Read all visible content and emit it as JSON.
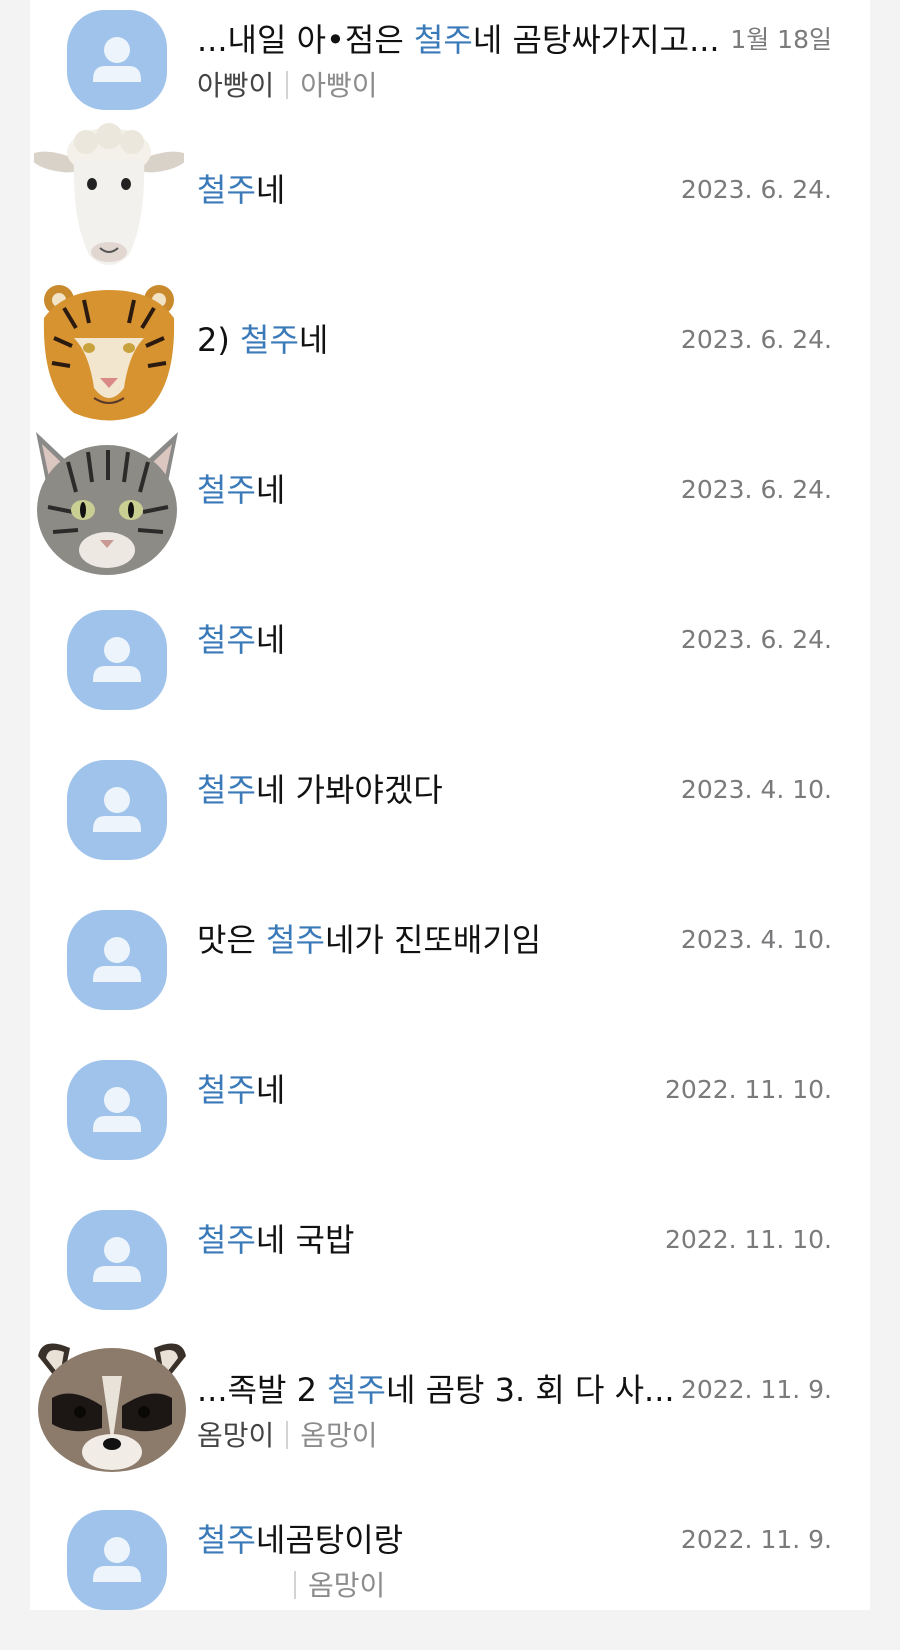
{
  "keyword": "철주",
  "rows": [
    {
      "pre": "...내일 아•점은 ",
      "hl": "철주",
      "post": "네 곰탕싸가지고...",
      "date": "1월 18일",
      "sub_a": "아빵이",
      "sub_b": "아빵이",
      "avatar": "default-avatar-icon"
    },
    {
      "pre": "",
      "hl": "철주",
      "post": "네",
      "date": "2023. 6. 24.",
      "avatar": "sheep-face"
    },
    {
      "pre": "2) ",
      "hl": "철주",
      "post": "네",
      "date": "2023. 6. 24.",
      "avatar": "tiger-face"
    },
    {
      "pre": "",
      "hl": "철주",
      "post": "네",
      "date": "2023. 6. 24.",
      "avatar": "cat-face"
    },
    {
      "pre": "",
      "hl": "철주",
      "post": "네",
      "date": "2023. 6. 24.",
      "avatar": "default-avatar-icon"
    },
    {
      "pre": "",
      "hl": "철주",
      "post": "네 가봐야겠다",
      "date": "2023. 4. 10.",
      "avatar": "default-avatar-icon"
    },
    {
      "pre": "맛은 ",
      "hl": "철주",
      "post": "네가 진또배기임",
      "date": "2023. 4. 10.",
      "avatar": "default-avatar-icon"
    },
    {
      "pre": "",
      "hl": "철주",
      "post": "네",
      "date": "2022. 11. 10.",
      "avatar": "default-avatar-icon"
    },
    {
      "pre": "",
      "hl": "철주",
      "post": "네 국밥",
      "date": "2022. 11. 10.",
      "avatar": "default-avatar-icon"
    },
    {
      "pre": "...족발 2 ",
      "hl": "철주",
      "post": "네 곰탕 3. 회 다 사...",
      "date": "2022. 11. 9.",
      "sub_a": "옴망이",
      "sub_b": "옴망이",
      "avatar": "raccoon-face"
    },
    {
      "pre": "",
      "hl": "철주",
      "post": "네곰탕이랑",
      "date": "2022. 11. 9.",
      "sub_a": "",
      "sub_b": "옴망이",
      "avatar": "default-avatar-icon"
    }
  ],
  "colors": {
    "highlight": "#3b7ab8",
    "avatar_bg": "#9fc3ea",
    "date": "#7a7a7c"
  }
}
